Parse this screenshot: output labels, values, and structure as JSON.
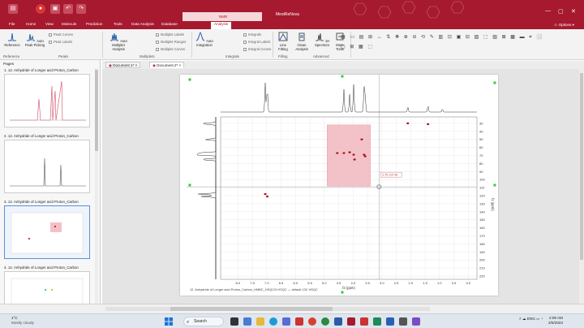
{
  "app": {
    "title": "MestReNova",
    "context_tab": "NMR",
    "options_label": "Options",
    "accent": "#a6192e"
  },
  "tabs": [
    "File",
    "Home",
    "View",
    "Molecule",
    "Prediction",
    "Tools",
    "Data Analysis",
    "Database",
    "Processing",
    "Analysis",
    "Assignments"
  ],
  "active_tab": "Analysis",
  "ribbon": {
    "reference": "Reference",
    "auto_peak_picking": "Auto Peak Picking",
    "peak_curves": "Peak Curves",
    "peak_labels": "Peak Labels",
    "peaks_group": "Peaks",
    "auto_multiplet": "Auto Multiplet Analysis",
    "multiplet_labels": "Multiplet Labels",
    "multiplet_ranges": "Multiplet Ranges",
    "multiplet_curves": "Multiplet Curves",
    "multiplets_group": "Multiplets",
    "auto_integration": "Auto Integration",
    "integrals": "Integrals",
    "integral_labels": "Integral Labels",
    "integral_curves": "Integral Curves",
    "integrals_group": "Integrals",
    "line_fitting": "Line Fitting",
    "clean_analysis": "Clean Analysis",
    "spectrum_1h": "1H Spectrum",
    "more_tools": "More Tools",
    "reference_group": "Reference",
    "filling_group": "Filling",
    "advanced_group": "Advanced"
  },
  "pages": {
    "header": "Pages",
    "items": [
      {
        "label": "1. 12. Anhydride of Longer acid Proton_Carbon"
      },
      {
        "label": "2. 12. Anhydride of Longer acid Proton_Carbon"
      },
      {
        "label": "3. 12. Anhydride of Longer acid Proton_Carbon"
      },
      {
        "label": "4. 12. Anhydride of Longer acid Proton_Carbon"
      }
    ],
    "selected_index": 2
  },
  "doc_tabs": [
    "Document 1*",
    "Document 2*"
  ],
  "active_doc": "Document 2*",
  "spectrum": {
    "footer": "12. Anhydride of Longer acid Proton_Carbon_HMBC_HSQC/3 HSQC — default 13C HSQC",
    "f2_label": "f2 (ppm)",
    "f1_label": "f1 (ppm)",
    "x_ticks": [
      "8.0",
      "7.5",
      "7.0",
      "6.5",
      "6.0",
      "5.5",
      "5.0",
      "4.5",
      "4.0",
      "3.5",
      "3.0",
      "2.5",
      "2.0",
      "1.5",
      "1.0",
      "0.5",
      "0.0"
    ],
    "y_ticks": [
      "30",
      "40",
      "50",
      "60",
      "70",
      "80",
      "90",
      "100",
      "110",
      "120",
      "130",
      "140",
      "150",
      "160",
      "170",
      "180",
      "190",
      "200",
      "210",
      "220"
    ],
    "cursor_readout": "2.75, 107.46",
    "x_range": [
      8.6,
      -0.3
    ],
    "y_range": [
      22,
      224
    ],
    "selection": {
      "x": [
        4.9,
        3.4
      ],
      "y": [
        32,
        108
      ]
    },
    "cross_peaks": [
      {
        "x": 4.32,
        "y": 67
      },
      {
        "x": 4.12,
        "y": 66
      },
      {
        "x": 3.98,
        "y": 69
      },
      {
        "x": 3.95,
        "y": 75
      },
      {
        "x": 3.62,
        "y": 69
      },
      {
        "x": 3.58,
        "y": 71
      },
      {
        "x": 4.55,
        "y": 67
      },
      {
        "x": 3.7,
        "y": 50
      },
      {
        "x": 7.05,
        "y": 118
      },
      {
        "x": 6.98,
        "y": 121
      },
      {
        "x": 2.1,
        "y": 30
      },
      {
        "x": 1.4,
        "y": 31
      }
    ]
  },
  "weather": {
    "temp": "1°C",
    "desc": "Mostly cloudy"
  },
  "taskbar": {
    "search": "Search",
    "lang": "ENG",
    "time": "2:09 AM",
    "date": "2/5/2023"
  }
}
